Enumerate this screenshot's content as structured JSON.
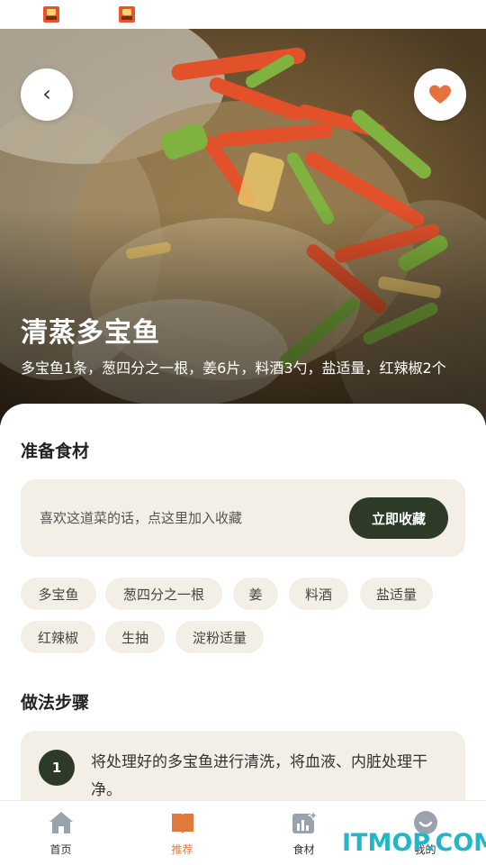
{
  "status_bar": {
    "icons": [
      "app-notification-icon",
      "app-notification-icon"
    ]
  },
  "hero": {
    "back_glyph": "‹",
    "title": "清蒸多宝鱼",
    "description": "多宝鱼1条，葱四分之一根，姜6片，料酒3勺，盐适量，红辣椒2个",
    "favorite_color": "#e8703a"
  },
  "ingredients_section": {
    "title": "准备食材",
    "collect_prompt": "喜欢这道菜的话，点这里加入收藏",
    "collect_button": "立即收藏",
    "tags": [
      "多宝鱼",
      "葱四分之一根",
      "姜",
      "料酒",
      "盐适量",
      "红辣椒",
      "生抽",
      "淀粉适量"
    ]
  },
  "steps_section": {
    "title": "做法步骤",
    "steps": [
      {
        "number": "1",
        "text": "将处理好的多宝鱼进行清洗，将血液、内脏处理干净。"
      }
    ]
  },
  "tabbar": {
    "tabs": [
      {
        "label": "首页",
        "icon": "home-icon",
        "active": false
      },
      {
        "label": "推荐",
        "icon": "book-icon",
        "active": true
      },
      {
        "label": "食材",
        "icon": "chart-sparkle-icon",
        "active": false
      },
      {
        "label": "我的",
        "icon": "smiley-icon",
        "active": false
      }
    ]
  },
  "watermark": "ITMOP.COM",
  "colors": {
    "accent": "#e07a3a",
    "dark_button": "#2d3a27",
    "card_bg": "#f4efe6",
    "watermark": "#20b8c8"
  }
}
